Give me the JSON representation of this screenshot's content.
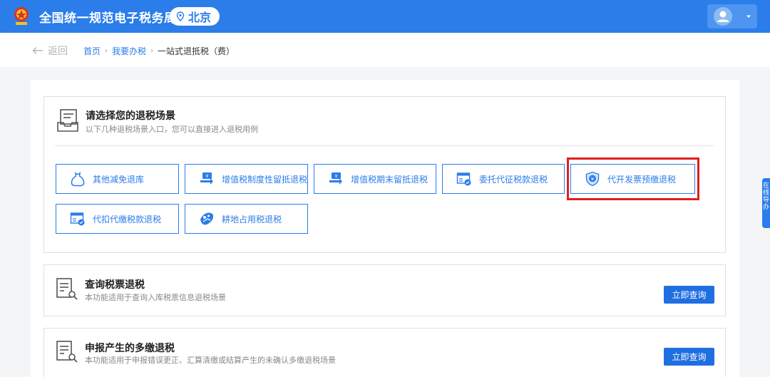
{
  "header": {
    "site_title": "全国统一规范电子税务局",
    "city": "北京",
    "icons": {
      "emblem": "tax-emblem-icon",
      "location": "location-pin-icon",
      "avatar": "user-avatar-icon",
      "caret": "caret-down-icon"
    }
  },
  "breadcrumb": {
    "back_label": "返回",
    "items": [
      "首页",
      "我要办税",
      "一站式退抵税（费）"
    ],
    "separator": "›"
  },
  "scene_section": {
    "title": "请选择您的退税场景",
    "desc": "以下几种退税场景入口，您可以直接进入退税用例",
    "buttons": [
      {
        "label": "其他减免退库",
        "icon": "bag-icon"
      },
      {
        "label": "增值税制度性留抵退税",
        "icon": "ticket-refund-icon"
      },
      {
        "label": "增值税期末留抵退税",
        "icon": "ticket-refund-icon"
      },
      {
        "label": "委托代征税款退税",
        "icon": "window-document-icon"
      },
      {
        "label": "代开发票预缴退税",
        "icon": "shield-yen-icon",
        "highlighted": true
      },
      {
        "label": "代扣代缴税款退税",
        "icon": "window-document-icon"
      },
      {
        "label": "耕地占用税退税",
        "icon": "land-icon"
      }
    ]
  },
  "query_section": {
    "title": "查询税票退税",
    "desc": "本功能适用于查询入库税票信息退税场景",
    "action": "立即查询"
  },
  "multi_section": {
    "title": "申报产生的多缴退税",
    "desc": "本功能适用于申报错误更正、汇算清缴或结算产生的未确认多缴退税场景",
    "action": "立即查询"
  },
  "side_tab": {
    "text": "在线导办"
  },
  "colors": {
    "brand": "#2b7de9",
    "highlight": "#e01e1e",
    "action": "#1f6fe0"
  }
}
